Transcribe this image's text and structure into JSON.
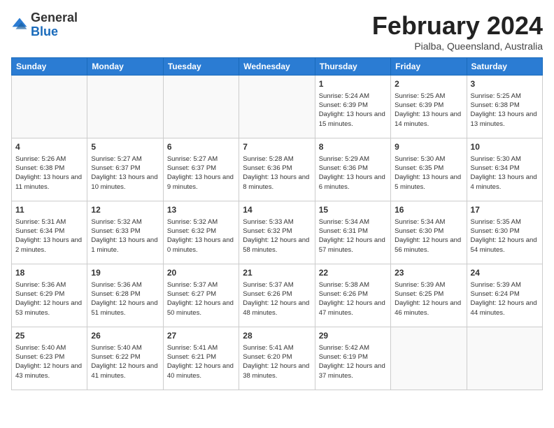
{
  "header": {
    "logo": {
      "general": "General",
      "blue": "Blue"
    },
    "title": "February 2024",
    "location": "Pialba, Queensland, Australia"
  },
  "days_of_week": [
    "Sunday",
    "Monday",
    "Tuesday",
    "Wednesday",
    "Thursday",
    "Friday",
    "Saturday"
  ],
  "weeks": [
    [
      {
        "day": "",
        "empty": true
      },
      {
        "day": "",
        "empty": true
      },
      {
        "day": "",
        "empty": true
      },
      {
        "day": "",
        "empty": true
      },
      {
        "day": "1",
        "sunrise": "5:24 AM",
        "sunset": "6:39 PM",
        "daylight": "13 hours and 15 minutes."
      },
      {
        "day": "2",
        "sunrise": "5:25 AM",
        "sunset": "6:39 PM",
        "daylight": "13 hours and 14 minutes."
      },
      {
        "day": "3",
        "sunrise": "5:25 AM",
        "sunset": "6:38 PM",
        "daylight": "13 hours and 13 minutes."
      }
    ],
    [
      {
        "day": "4",
        "sunrise": "5:26 AM",
        "sunset": "6:38 PM",
        "daylight": "13 hours and 11 minutes."
      },
      {
        "day": "5",
        "sunrise": "5:27 AM",
        "sunset": "6:37 PM",
        "daylight": "13 hours and 10 minutes."
      },
      {
        "day": "6",
        "sunrise": "5:27 AM",
        "sunset": "6:37 PM",
        "daylight": "13 hours and 9 minutes."
      },
      {
        "day": "7",
        "sunrise": "5:28 AM",
        "sunset": "6:36 PM",
        "daylight": "13 hours and 8 minutes."
      },
      {
        "day": "8",
        "sunrise": "5:29 AM",
        "sunset": "6:36 PM",
        "daylight": "13 hours and 6 minutes."
      },
      {
        "day": "9",
        "sunrise": "5:30 AM",
        "sunset": "6:35 PM",
        "daylight": "13 hours and 5 minutes."
      },
      {
        "day": "10",
        "sunrise": "5:30 AM",
        "sunset": "6:34 PM",
        "daylight": "13 hours and 4 minutes."
      }
    ],
    [
      {
        "day": "11",
        "sunrise": "5:31 AM",
        "sunset": "6:34 PM",
        "daylight": "13 hours and 2 minutes."
      },
      {
        "day": "12",
        "sunrise": "5:32 AM",
        "sunset": "6:33 PM",
        "daylight": "13 hours and 1 minute."
      },
      {
        "day": "13",
        "sunrise": "5:32 AM",
        "sunset": "6:32 PM",
        "daylight": "13 hours and 0 minutes."
      },
      {
        "day": "14",
        "sunrise": "5:33 AM",
        "sunset": "6:32 PM",
        "daylight": "12 hours and 58 minutes."
      },
      {
        "day": "15",
        "sunrise": "5:34 AM",
        "sunset": "6:31 PM",
        "daylight": "12 hours and 57 minutes."
      },
      {
        "day": "16",
        "sunrise": "5:34 AM",
        "sunset": "6:30 PM",
        "daylight": "12 hours and 56 minutes."
      },
      {
        "day": "17",
        "sunrise": "5:35 AM",
        "sunset": "6:30 PM",
        "daylight": "12 hours and 54 minutes."
      }
    ],
    [
      {
        "day": "18",
        "sunrise": "5:36 AM",
        "sunset": "6:29 PM",
        "daylight": "12 hours and 53 minutes."
      },
      {
        "day": "19",
        "sunrise": "5:36 AM",
        "sunset": "6:28 PM",
        "daylight": "12 hours and 51 minutes."
      },
      {
        "day": "20",
        "sunrise": "5:37 AM",
        "sunset": "6:27 PM",
        "daylight": "12 hours and 50 minutes."
      },
      {
        "day": "21",
        "sunrise": "5:37 AM",
        "sunset": "6:26 PM",
        "daylight": "12 hours and 48 minutes."
      },
      {
        "day": "22",
        "sunrise": "5:38 AM",
        "sunset": "6:26 PM",
        "daylight": "12 hours and 47 minutes."
      },
      {
        "day": "23",
        "sunrise": "5:39 AM",
        "sunset": "6:25 PM",
        "daylight": "12 hours and 46 minutes."
      },
      {
        "day": "24",
        "sunrise": "5:39 AM",
        "sunset": "6:24 PM",
        "daylight": "12 hours and 44 minutes."
      }
    ],
    [
      {
        "day": "25",
        "sunrise": "5:40 AM",
        "sunset": "6:23 PM",
        "daylight": "12 hours and 43 minutes."
      },
      {
        "day": "26",
        "sunrise": "5:40 AM",
        "sunset": "6:22 PM",
        "daylight": "12 hours and 41 minutes."
      },
      {
        "day": "27",
        "sunrise": "5:41 AM",
        "sunset": "6:21 PM",
        "daylight": "12 hours and 40 minutes."
      },
      {
        "day": "28",
        "sunrise": "5:41 AM",
        "sunset": "6:20 PM",
        "daylight": "12 hours and 38 minutes."
      },
      {
        "day": "29",
        "sunrise": "5:42 AM",
        "sunset": "6:19 PM",
        "daylight": "12 hours and 37 minutes."
      },
      {
        "day": "",
        "empty": true
      },
      {
        "day": "",
        "empty": true
      }
    ]
  ],
  "labels": {
    "sunrise_prefix": "Sunrise: ",
    "sunset_prefix": "Sunset: ",
    "daylight_prefix": "Daylight: "
  }
}
